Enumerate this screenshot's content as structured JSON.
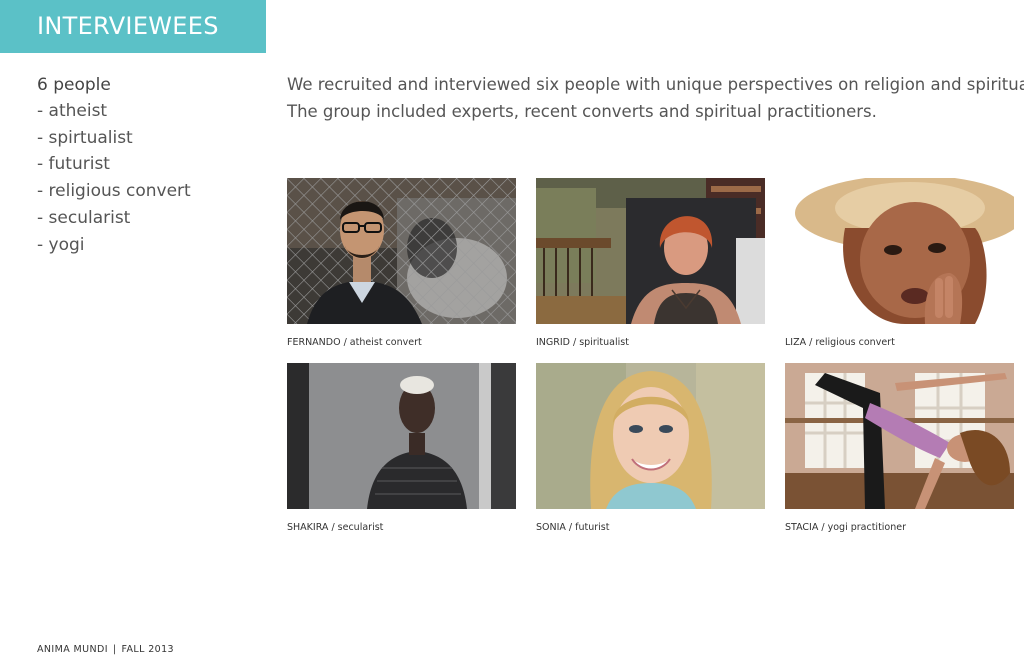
{
  "header": {
    "title": "INTERVIEWEES",
    "accent_color": "#5bc1c7"
  },
  "sidebar": {
    "heading": "6 people",
    "items": [
      "- atheist",
      "- spirtualist",
      "- futurist",
      "- religious convert",
      "- secularist",
      "- yogi"
    ]
  },
  "intro": {
    "line1": "We recruited and interviewed six people with unique perspectives on religion and spirituality.",
    "line2": "The group included experts, recent converts and spiritual practitioners."
  },
  "interviewees": [
    {
      "caption": "FERNANDO / atheist convert",
      "photo": "portrait-man-glasses-chainlink-fence"
    },
    {
      "caption": "INGRID / spiritualist",
      "photo": "portrait-woman-red-hair-indoor"
    },
    {
      "caption": "LIZA / religious convert",
      "photo": "portrait-woman-straw-hat"
    },
    {
      "caption": "SHAKIRA / secularist",
      "photo": "portrait-woman-window-backlit"
    },
    {
      "caption": "SONIA / futurist",
      "photo": "portrait-woman-blonde-smiling"
    },
    {
      "caption": "STACIA / yogi practitioner",
      "photo": "photo-woman-yoga-pose"
    }
  ],
  "footer": {
    "project": "ANIMA MUNDI",
    "separator": "|",
    "term": "FALL 2013"
  }
}
